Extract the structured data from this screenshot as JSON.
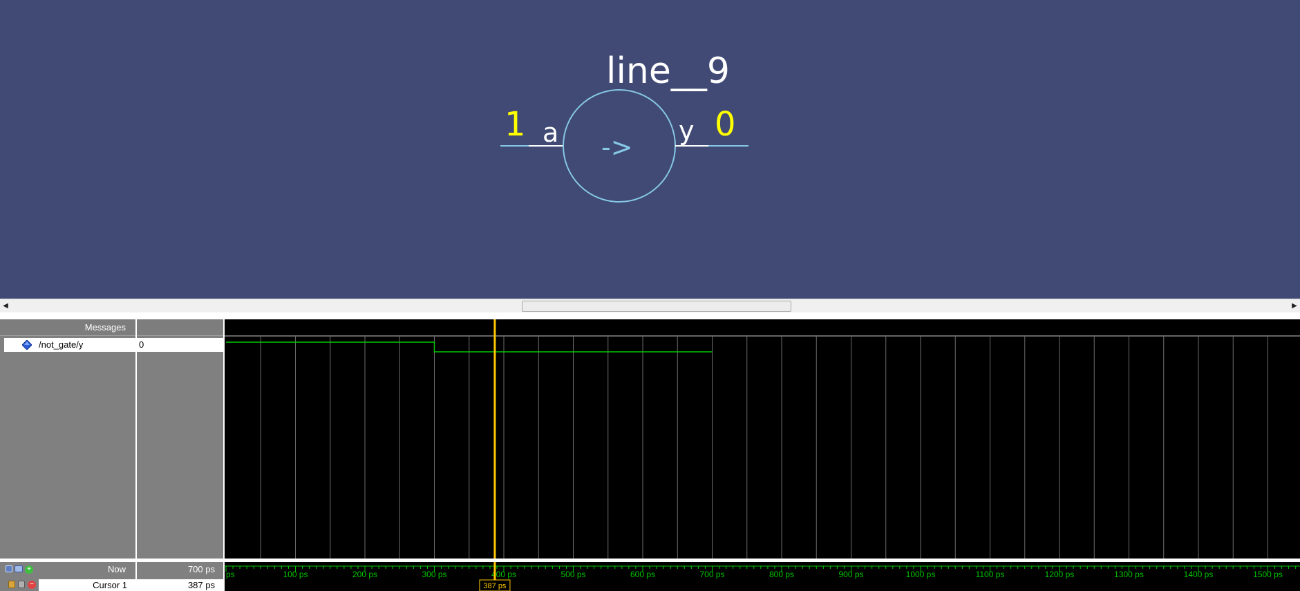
{
  "schematic": {
    "instance_name": "line__9",
    "operator_symbol": "->",
    "input_port": {
      "name": "a",
      "value": "1"
    },
    "output_port": {
      "name": "y",
      "value": "0"
    },
    "colors": {
      "background": "#404a74",
      "wire": "#87c8e6",
      "value": "#ffff00",
      "label": "#ffffff"
    }
  },
  "wave": {
    "signals_header": "Messages",
    "signals": [
      {
        "name": "/not_gate/y",
        "value": "0"
      }
    ],
    "now_label": "Now",
    "now_value": "700 ps",
    "cursor_label": "Cursor 1",
    "cursor_value": "387 ps",
    "cursor_marker": "387 ps",
    "cursor_time_ps": 387,
    "axis_ticks": [
      "ps",
      "100 ps",
      "200 ps",
      "300 ps",
      "400 ps",
      "500 ps",
      "600 ps",
      "700 ps",
      "800 ps",
      "900 ps",
      "1000 ps",
      "1100 ps",
      "1200 ps",
      "1300 ps",
      "1400 ps",
      "1500 ps"
    ],
    "waveform": {
      "signal": "/not_gate/y",
      "transitions": [
        {
          "time_ps": 0,
          "level": 1
        },
        {
          "time_ps": 300,
          "level": 0
        },
        {
          "time_ps": 700,
          "level": null
        }
      ]
    },
    "colors": {
      "wave": "#00c800",
      "cursor": "#ffc800",
      "axis": "#00c800"
    }
  },
  "icons": [
    "diamond-icon",
    "zoom-icon",
    "window-icon",
    "add-icon",
    "lock-icon",
    "edit-icon",
    "remove-icon"
  ]
}
